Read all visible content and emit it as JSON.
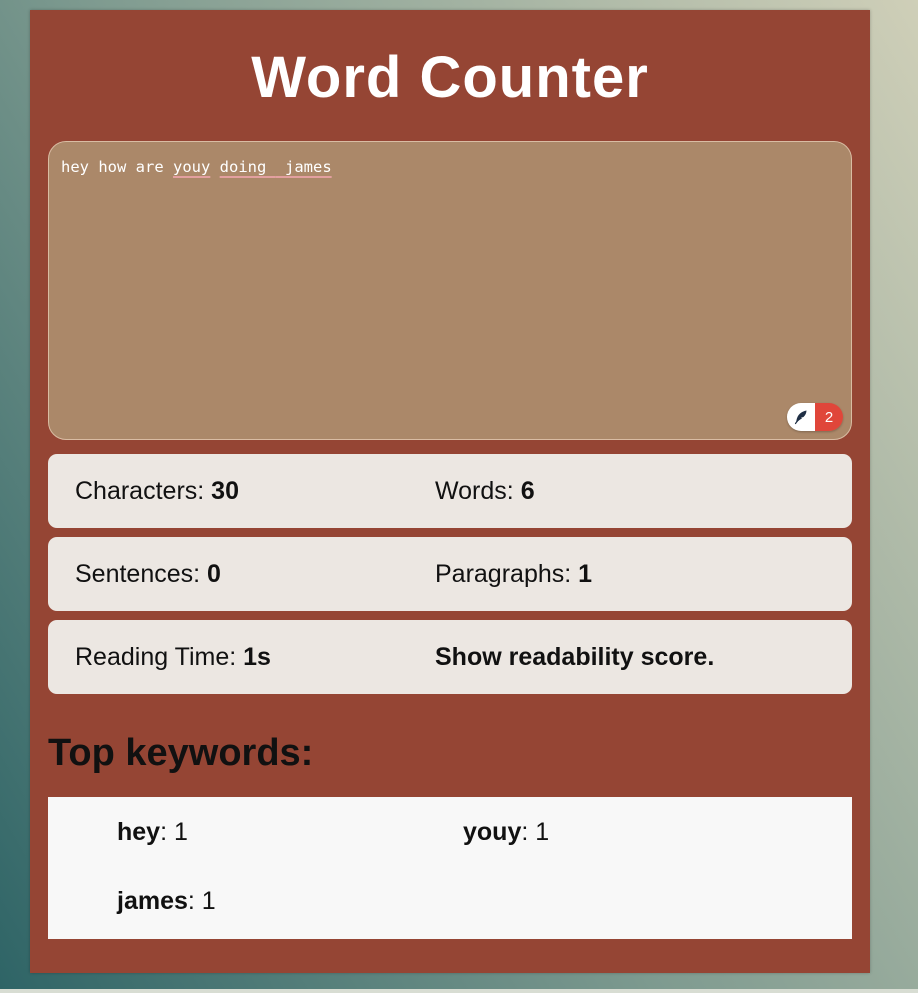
{
  "page": {
    "title": "Word Counter"
  },
  "editor": {
    "words": [
      "hey",
      "how",
      "are",
      "youy",
      "doing",
      "james"
    ],
    "text_part1": "hey how are ",
    "text_youy": "youy",
    "text_space": " ",
    "text_doing": "doing ",
    "text_james": " james",
    "grammar_count": "2"
  },
  "stats": {
    "characters_label": "Characters:",
    "characters_value": "30",
    "words_label": "Words:",
    "words_value": "6",
    "sentences_label": "Sentences:",
    "sentences_value": "0",
    "paragraphs_label": "Paragraphs:",
    "paragraphs_value": "1",
    "reading_time_label": "Reading Time:",
    "reading_time_value": "1s",
    "readability_link": "Show readability score."
  },
  "keywords": {
    "heading": "Top keywords:",
    "items": [
      {
        "word": "hey",
        "count": ": 1"
      },
      {
        "word": "youy",
        "count": ": 1"
      },
      {
        "word": "james",
        "count": ": 1"
      }
    ]
  },
  "colors": {
    "card": "#954534",
    "editor_bg": "#ab8869",
    "stat_bg": "#ece7e2",
    "keyword_bg": "#f8f8f8",
    "grammar_badge": "#e0463a"
  },
  "icons": {
    "grammar": "feather-icon"
  }
}
